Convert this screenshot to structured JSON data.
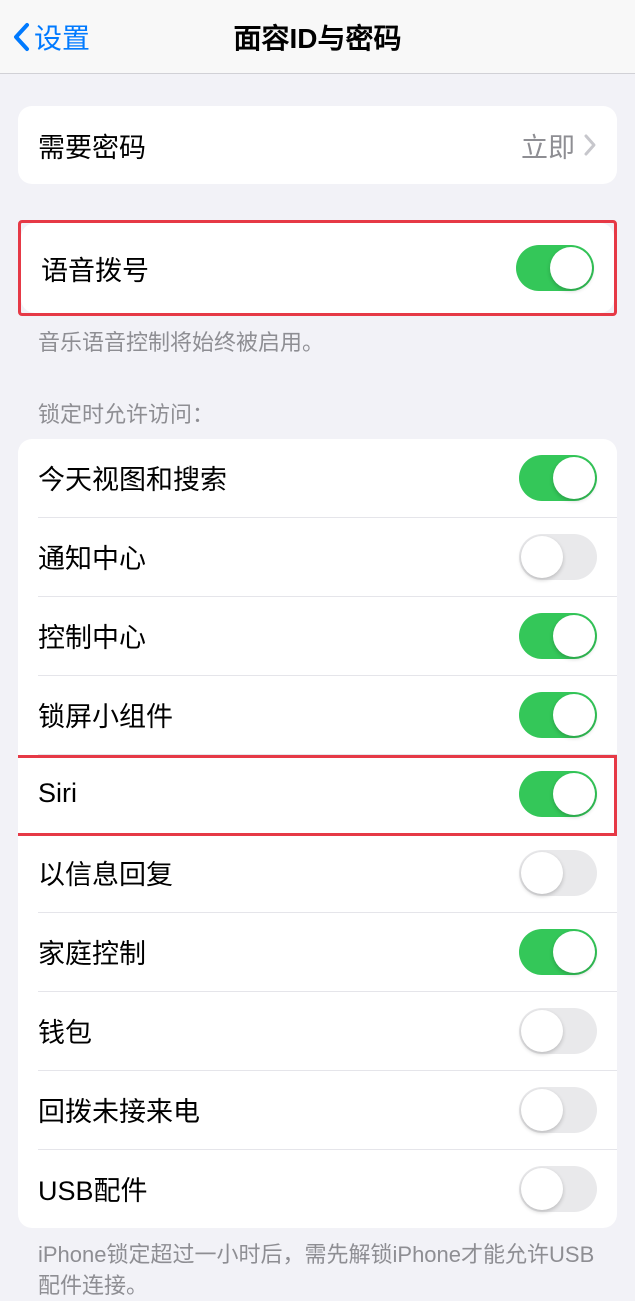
{
  "header": {
    "back_label": "设置",
    "title": "面容ID与密码"
  },
  "section_passcode": {
    "require_passcode_label": "需要密码",
    "require_passcode_value": "立即"
  },
  "section_voice": {
    "voice_dial_label": "语音拨号",
    "voice_dial_on": true,
    "footer": "音乐语音控制将始终被启用。"
  },
  "section_lock_access": {
    "header": "锁定时允许访问：",
    "items": [
      {
        "label": "今天视图和搜索",
        "on": true
      },
      {
        "label": "通知中心",
        "on": false
      },
      {
        "label": "控制中心",
        "on": true
      },
      {
        "label": "锁屏小组件",
        "on": true
      },
      {
        "label": "Siri",
        "on": true
      },
      {
        "label": "以信息回复",
        "on": false
      },
      {
        "label": "家庭控制",
        "on": true
      },
      {
        "label": "钱包",
        "on": false
      },
      {
        "label": "回拨未接来电",
        "on": false
      },
      {
        "label": "USB配件",
        "on": false
      }
    ],
    "footer": "iPhone锁定超过一小时后，需先解锁iPhone才能允许USB配件连接。"
  }
}
